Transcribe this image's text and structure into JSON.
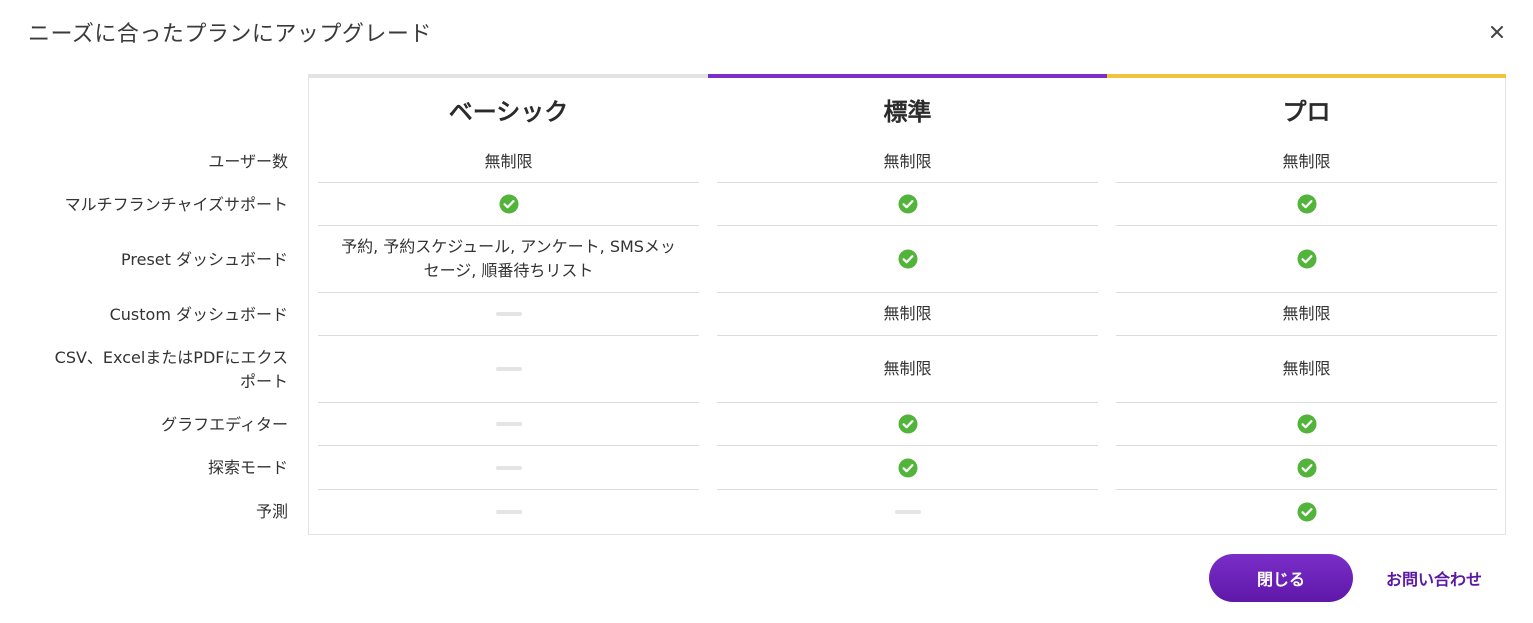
{
  "dialog": {
    "title": "ニーズに合ったプランにアップグレード",
    "close_icon": "close-icon"
  },
  "features": [
    "ユーザー数",
    "マルチフランチャイズサポート",
    "Preset ダッシュボード",
    "Custom ダッシュボード",
    "CSV、ExcelまたはPDFにエクスポート",
    "グラフエディター",
    "探索モード",
    "予測"
  ],
  "plans": [
    {
      "name": "ベーシック",
      "accent": "#e3e3e3",
      "cells": [
        {
          "type": "text",
          "value": "無制限"
        },
        {
          "type": "check",
          "icon": "check-circle-icon"
        },
        {
          "type": "text",
          "value": "予約, 予約スケジュール, アンケート, SMSメッセージ, 順番待ちリスト"
        },
        {
          "type": "dash",
          "icon": "dash-icon"
        },
        {
          "type": "dash",
          "icon": "dash-icon"
        },
        {
          "type": "dash",
          "icon": "dash-icon"
        },
        {
          "type": "dash",
          "icon": "dash-icon"
        },
        {
          "type": "dash",
          "icon": "dash-icon"
        }
      ]
    },
    {
      "name": "標準",
      "accent": "#7b2fc9",
      "cells": [
        {
          "type": "text",
          "value": "無制限"
        },
        {
          "type": "check",
          "icon": "check-circle-icon"
        },
        {
          "type": "check",
          "icon": "check-circle-icon"
        },
        {
          "type": "text",
          "value": "無制限"
        },
        {
          "type": "text",
          "value": "無制限"
        },
        {
          "type": "check",
          "icon": "check-circle-icon"
        },
        {
          "type": "check",
          "icon": "check-circle-icon"
        },
        {
          "type": "dash",
          "icon": "dash-icon"
        }
      ]
    },
    {
      "name": "プロ",
      "accent": "#f0c33c",
      "cells": [
        {
          "type": "text",
          "value": "無制限"
        },
        {
          "type": "check",
          "icon": "check-circle-icon"
        },
        {
          "type": "check",
          "icon": "check-circle-icon"
        },
        {
          "type": "text",
          "value": "無制限"
        },
        {
          "type": "text",
          "value": "無制限"
        },
        {
          "type": "check",
          "icon": "check-circle-icon"
        },
        {
          "type": "check",
          "icon": "check-circle-icon"
        },
        {
          "type": "check",
          "icon": "check-circle-icon"
        }
      ]
    }
  ],
  "colors": {
    "check_green": "#52b43a",
    "primary_purple": "#6b1fb5"
  },
  "footer": {
    "close_label": "閉じる",
    "contact_label": "お問い合わせ"
  }
}
